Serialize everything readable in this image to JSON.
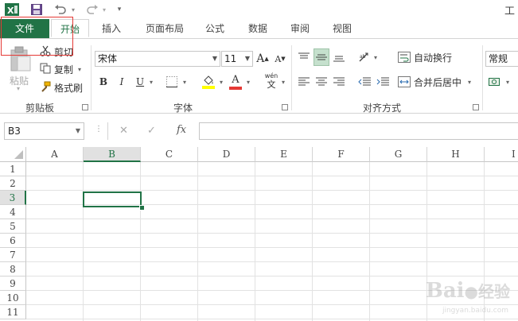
{
  "title_fragment": "工",
  "quick_access": {
    "icons": [
      "excel-logo-icon",
      "save-icon",
      "undo-icon",
      "redo-icon",
      "customize-icon"
    ]
  },
  "tabs": [
    {
      "label": "文件",
      "type": "file"
    },
    {
      "label": "开始",
      "type": "active"
    },
    {
      "label": "插入"
    },
    {
      "label": "页面布局"
    },
    {
      "label": "公式"
    },
    {
      "label": "数据"
    },
    {
      "label": "审阅"
    },
    {
      "label": "视图"
    }
  ],
  "ribbon": {
    "clipboard": {
      "group_label": "剪贴板",
      "paste_label": "粘贴",
      "cut_label": "剪切",
      "copy_label": "复制",
      "format_painter_label": "格式刷"
    },
    "font": {
      "group_label": "字体",
      "font_name": "宋体",
      "font_size": "11",
      "bold": "B",
      "italic": "I",
      "underline": "U",
      "grow": "A",
      "shrink": "A",
      "font_color_letter": "A",
      "phonetic_top": "wén",
      "phonetic_bottom": "文",
      "fill_color": "#ffff00",
      "font_color": "#e53935"
    },
    "alignment": {
      "group_label": "对齐方式",
      "wrap_text_label": "自动换行",
      "merge_center_label": "合并后居中"
    },
    "number": {
      "format": "常规"
    }
  },
  "formula_bar": {
    "name_box": "B3",
    "cancel": "✕",
    "enter": "✓",
    "fx": "fx",
    "value": ""
  },
  "sheet": {
    "columns": [
      "A",
      "B",
      "C",
      "D",
      "E",
      "F",
      "G",
      "H",
      "I"
    ],
    "rows": [
      "1",
      "2",
      "3",
      "4",
      "5",
      "6",
      "7",
      "8",
      "9",
      "10",
      "11"
    ],
    "selected_column": "B",
    "selected_row": "3"
  },
  "watermark": {
    "brand": "Bai",
    "brand_suffix": "经验",
    "url": "jingyan.baidu.com"
  }
}
